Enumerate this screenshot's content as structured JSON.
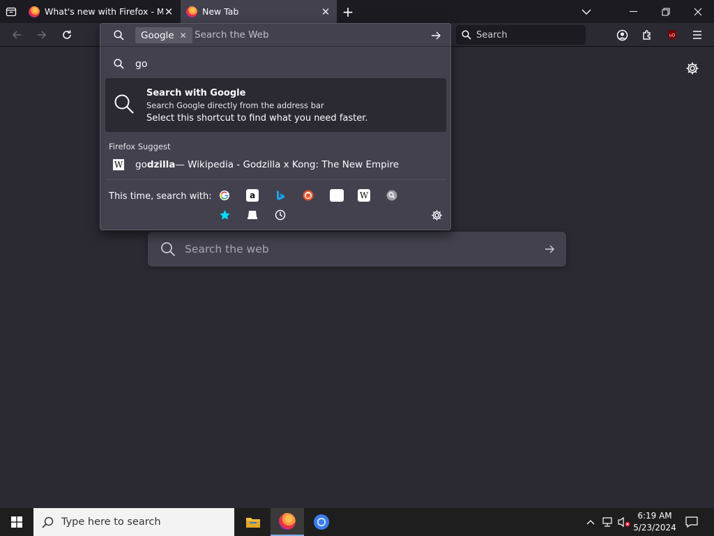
{
  "tabs": [
    {
      "title": "What's new with Firefox - More",
      "active": false
    },
    {
      "title": "New Tab",
      "active": true
    }
  ],
  "icons": {
    "tab_manager": "tab-manager-icon",
    "new_tab": "plus-icon",
    "list_all_tabs": "chevron-down-icon",
    "back": "back-arrow-icon",
    "forward": "forward-arrow-icon",
    "reload": "reload-icon",
    "account": "account-icon",
    "extensions": "puzzle-icon",
    "ublock": "ublock-icon",
    "menu": "hamburger-icon"
  },
  "toolbar": {
    "search_placeholder": "Search"
  },
  "urlbar": {
    "engine_chip": "Google",
    "placeholder": "Search the Web",
    "typed": "go",
    "results": {
      "selected": {
        "title": "Search with Google",
        "subtitle": "Search Google directly from the address bar",
        "description": "Select this shortcut to find what you need faster."
      },
      "suggest_label": "Firefox Suggest",
      "wiki_icon": "W",
      "wiki_bold_prefix": "go",
      "wiki_bold": "dzilla",
      "wiki_rest": " — Wikipedia - Godzilla x Kong: The New Empire"
    },
    "search_with_label": "This time, search with:",
    "engines": [
      "google-icon",
      "amazon-icon",
      "bing-icon",
      "duckduckgo-icon",
      "ebay-icon",
      "wikipedia-icon",
      "search-engine-icon",
      "bookmarks-star-icon",
      "tabs-icon",
      "history-clock-icon"
    ],
    "ebay_text": "ebay",
    "amazon_text": "a"
  },
  "page": {
    "search_placeholder": "Search the web"
  },
  "taskbar": {
    "search_placeholder": "Type here to search",
    "time": "6:19 AM",
    "date": "5/23/2024"
  },
  "colors": {
    "bg": "#2b2a33",
    "panel": "#42414d",
    "tabstrip": "#1c1b22",
    "accent": "#00ddff"
  }
}
